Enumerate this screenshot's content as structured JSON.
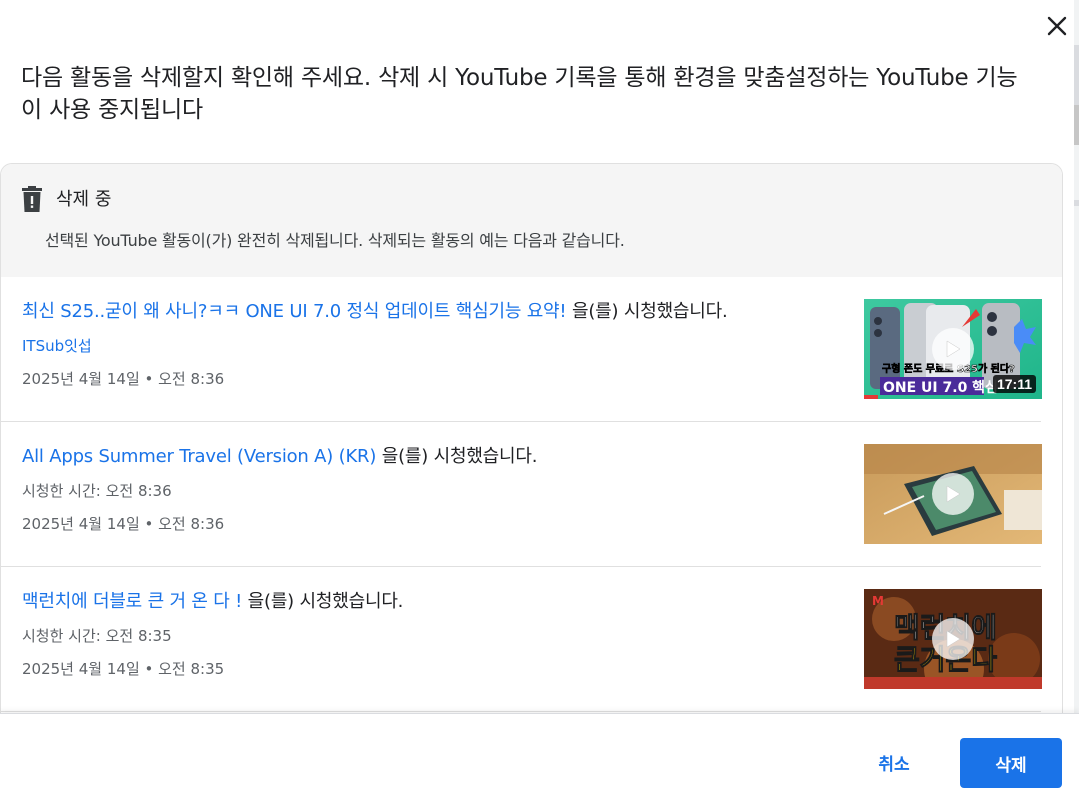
{
  "dialog": {
    "heading": "다음 활동을 삭제할지 확인해 주세요. 삭제 시 YouTube 기록을 통해 환경을 맞춤설정하는 YouTube 기능이 사용 중지됩니다"
  },
  "card": {
    "title": "삭제 중",
    "description": "선택된 YouTube 활동이(가) 완전히 삭제됩니다. 삭제되는 활동의 예는 다음과 같습니다."
  },
  "items": [
    {
      "link": "최신 S25..굳이 왜 사니?ㅋㅋ ONE UI 7.0 정식 업데이트 핵심기능 요약!",
      "suffix": " 을(를) 시청했습니다.",
      "sub": "ITSub잇섭",
      "date": "2025년 4월 14일 • 오전 8:36",
      "duration": "17:11",
      "thumb_caption_top": "구형 폰도 무료로 S25가 된다?",
      "thumb_caption_bottom": "ONE UI 7.0 핵심"
    },
    {
      "link": "All Apps Summer Travel (Version A) (KR)",
      "suffix": " 을(를) 시청했습니다.",
      "sub": "시청한 시간: 오전 8:36",
      "date": "2025년 4월 14일 • 오전 8:36"
    },
    {
      "link": "맥런치에 더블로 큰 거 온 다 !",
      "suffix": " 을(를) 시청했습니다.",
      "sub": "시청한 시간: 오전 8:35",
      "date": "2025년 4월 14일 • 오전 8:35",
      "thumb_caption_top": "맥런치에",
      "thumb_caption_bottom": "큰거온다"
    }
  ],
  "footer": {
    "cancel_label": "취소",
    "delete_label": "삭제"
  },
  "colors": {
    "accent": "#1a73e8",
    "card_header_bg": "#f5f5f5"
  },
  "icons": [
    "close-icon",
    "trash-icon",
    "play-icon"
  ]
}
